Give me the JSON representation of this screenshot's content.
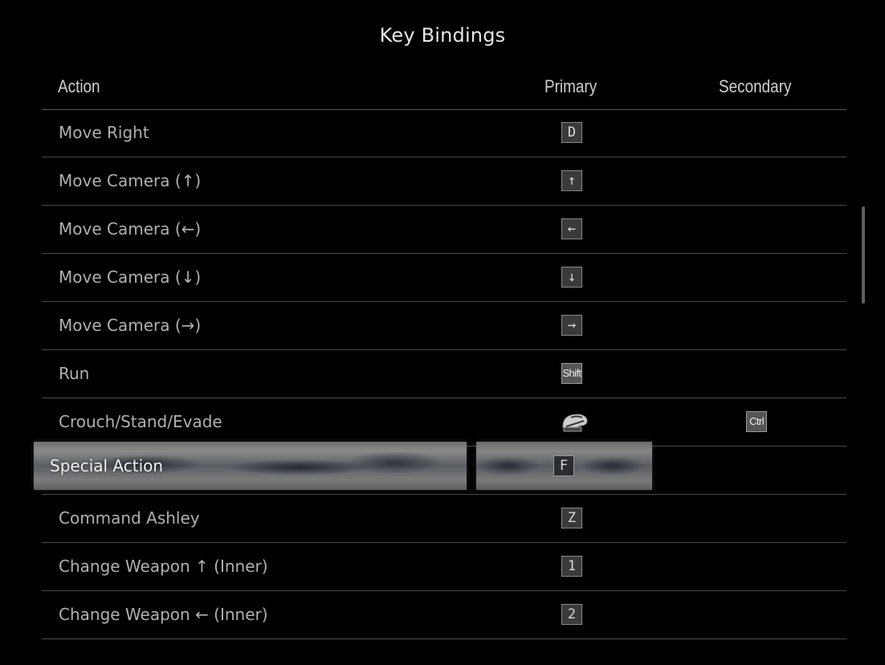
{
  "screen": {
    "title": "Key Bindings"
  },
  "columns": {
    "action": "Action",
    "primary": "Primary",
    "secondary": "Secondary"
  },
  "rows": [
    {
      "action": "Move Right",
      "primary": "D",
      "secondary": ""
    },
    {
      "action": "Move Camera (↑)",
      "primary": "↑",
      "secondary": ""
    },
    {
      "action": "Move Camera (←)",
      "primary": "←",
      "secondary": ""
    },
    {
      "action": "Move Camera (↓)",
      "primary": "↓",
      "secondary": ""
    },
    {
      "action": "Move Camera (→)",
      "primary": "→",
      "secondary": ""
    },
    {
      "action": "Run",
      "primary": "Shift",
      "secondary": ""
    },
    {
      "action": "Crouch/Stand/Evade",
      "primary_icon": "mouse-middle-button-icon",
      "secondary": "Ctrl"
    },
    {
      "action": "Special Action",
      "primary": "F",
      "secondary": "",
      "selected": true
    },
    {
      "action": "Command Ashley",
      "primary": "Z",
      "secondary": ""
    },
    {
      "action": "Change Weapon ↑ (Inner)",
      "primary": "1",
      "secondary": ""
    },
    {
      "action": "Change Weapon ← (Inner)",
      "primary": "2",
      "secondary": ""
    }
  ],
  "colors": {
    "background": "#000000",
    "text": "#b0b0b0",
    "divider": "#4a4a4a"
  }
}
